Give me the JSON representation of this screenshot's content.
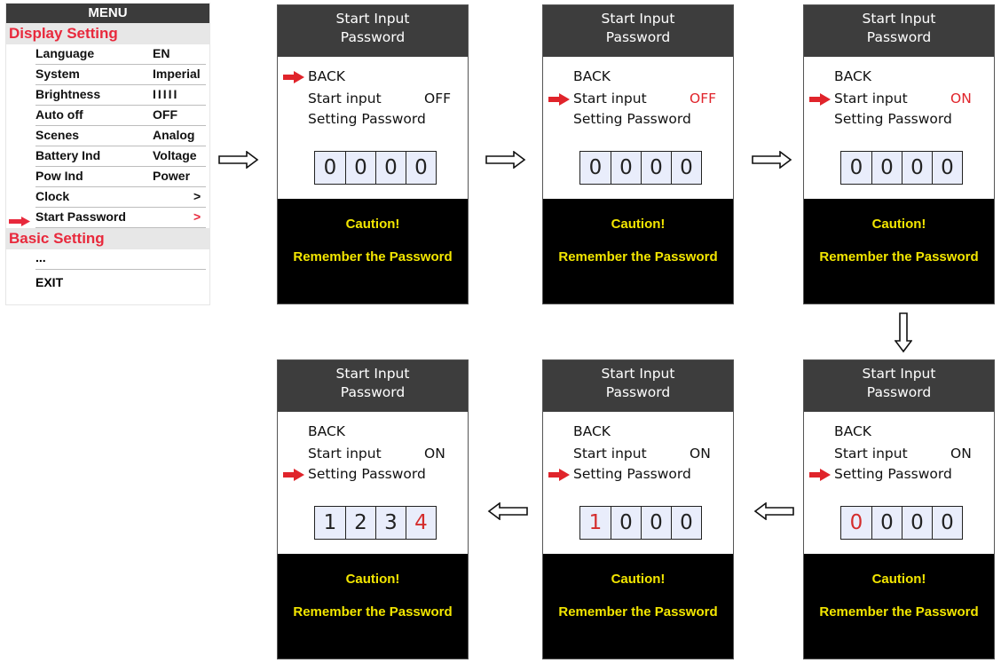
{
  "menu": {
    "title": "MENU",
    "display_section": "Display Setting",
    "rows": [
      {
        "label": "Language",
        "value": "EN"
      },
      {
        "label": "System",
        "value": "Imperial"
      },
      {
        "label": "Brightness",
        "value": "IIIII"
      },
      {
        "label": "Auto off",
        "value": "OFF"
      },
      {
        "label": "Scenes",
        "value": "Analog"
      },
      {
        "label": "Battery Ind",
        "value": "Voltage"
      },
      {
        "label": "Pow Ind",
        "value": "Power"
      },
      {
        "label": "Clock",
        "value": ">"
      },
      {
        "label": "Start Password",
        "value": ">"
      }
    ],
    "basic_section": "Basic Setting",
    "ellipsis": "...",
    "exit": "EXIT"
  },
  "common": {
    "header_line1": "Start Input",
    "header_line2": "Password",
    "back": "BACK",
    "start_input": "Start input",
    "setting_password": "Setting Password",
    "caution": "Caution!",
    "remember": "Remember the Password"
  },
  "screens": [
    {
      "selected": "BACK",
      "start_value": "OFF",
      "start_value_color": "#111111",
      "digits": [
        "0",
        "0",
        "0",
        "0"
      ],
      "highlight_index": -1
    },
    {
      "selected": "Start input",
      "start_value": "OFF",
      "start_value_color": "#e0242b",
      "digits": [
        "0",
        "0",
        "0",
        "0"
      ],
      "highlight_index": -1
    },
    {
      "selected": "Start input",
      "start_value": "ON",
      "start_value_color": "#e0242b",
      "digits": [
        "0",
        "0",
        "0",
        "0"
      ],
      "highlight_index": -1
    },
    {
      "selected": "Setting Password",
      "start_value": "ON",
      "start_value_color": "#111111",
      "digits": [
        "0",
        "0",
        "0",
        "0"
      ],
      "highlight_index": 0
    },
    {
      "selected": "Setting Password",
      "start_value": "ON",
      "start_value_color": "#111111",
      "digits": [
        "1",
        "0",
        "0",
        "0"
      ],
      "highlight_index": 0
    },
    {
      "selected": "Setting Password",
      "start_value": "ON",
      "start_value_color": "#111111",
      "digits": [
        "1",
        "2",
        "3",
        "4"
      ],
      "highlight_index": 3
    }
  ],
  "colors": {
    "accent_red": "#e8293c",
    "caution_yellow": "#f3e600",
    "header_gray": "#3d3d3d",
    "digit_box": "#e9edfb"
  }
}
